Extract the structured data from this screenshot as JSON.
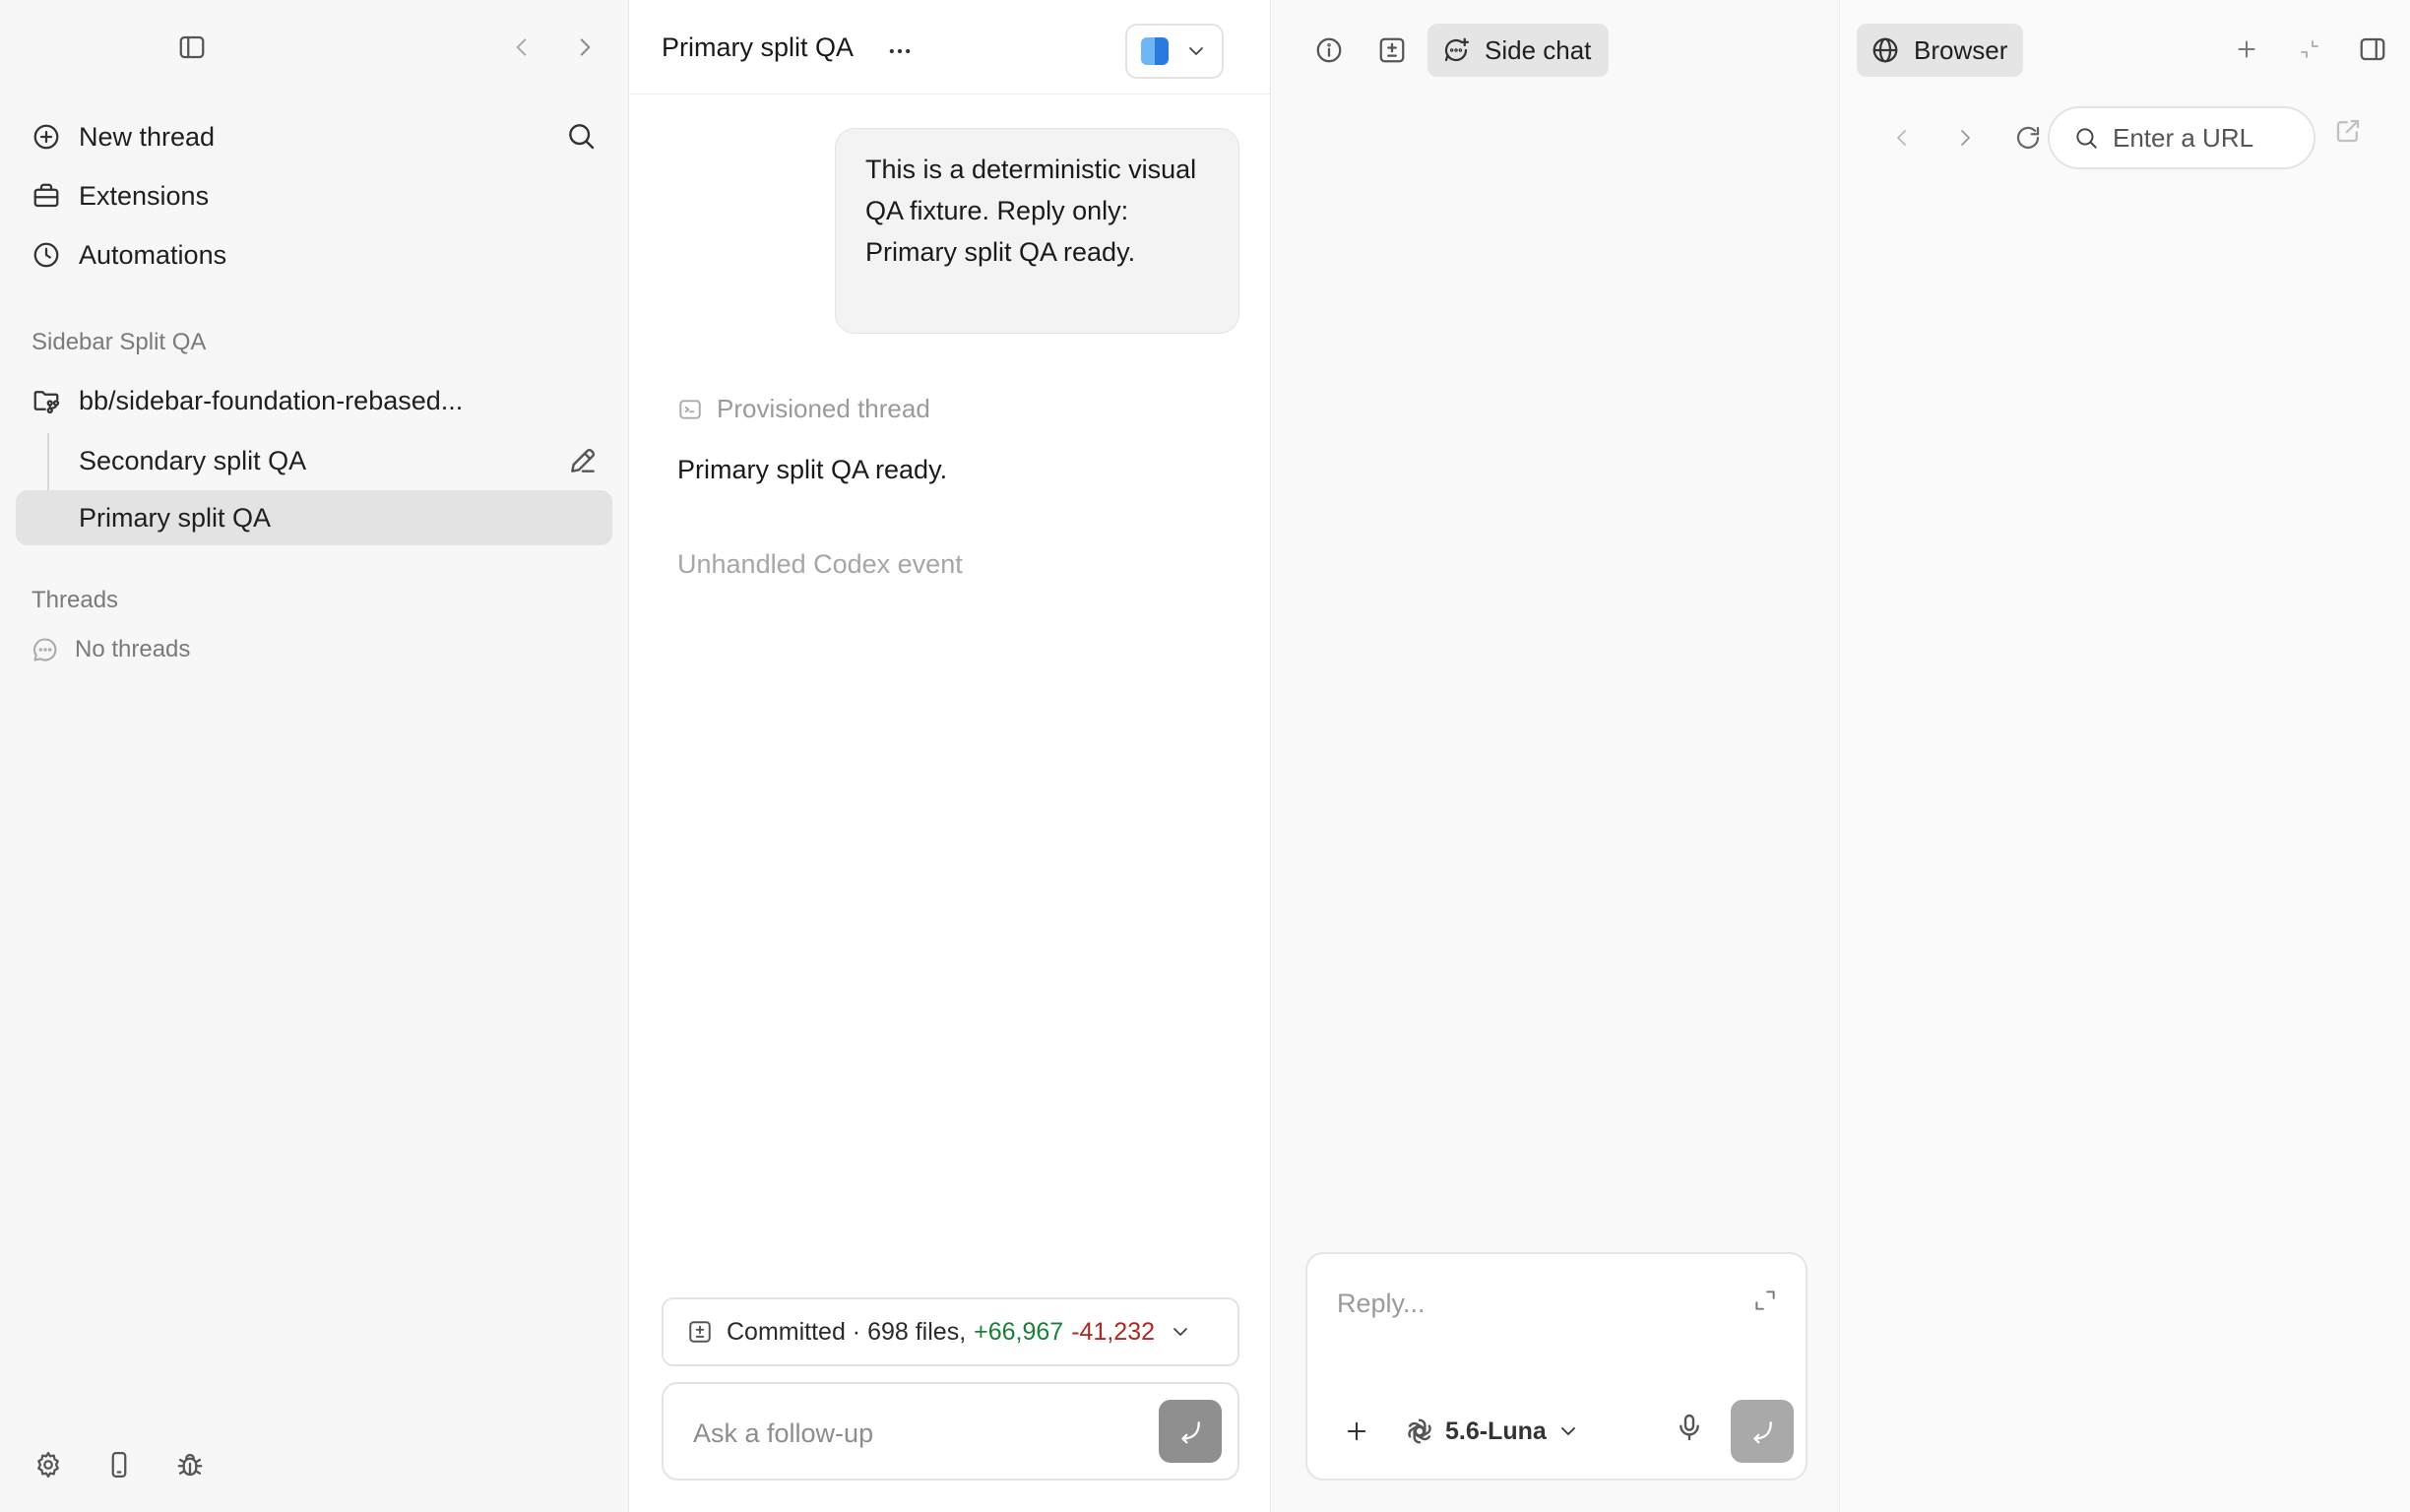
{
  "sidebar": {
    "nav": {
      "new_thread": "New thread",
      "extensions": "Extensions",
      "automations": "Automations"
    },
    "project_section": "Sidebar Split QA",
    "project_branch": "bb/sidebar-foundation-rebased...",
    "threads": [
      {
        "label": "Secondary split QA"
      },
      {
        "label": "Primary split QA"
      }
    ],
    "threads_section": "Threads",
    "no_threads": "No threads"
  },
  "main": {
    "title": "Primary split QA",
    "user_message": "This is a deterministic visual QA fixture. Reply only: Primary split QA ready.",
    "provisioned": "Provisioned thread",
    "assistant_reply": "Primary split QA ready.",
    "unhandled_event": "Unhandled Codex event",
    "commit": {
      "label": "Committed · 698 files,",
      "additions": "+66,967",
      "deletions": "-41,232"
    },
    "followup_placeholder": "Ask a follow-up"
  },
  "side_chat": {
    "tab_label": "Side chat",
    "reply_placeholder": "Reply...",
    "model": "5.6-Luna"
  },
  "browser": {
    "tab_label": "Browser",
    "url_placeholder": "Enter a URL"
  },
  "colors": {
    "additions": "#1a7f37",
    "deletions": "#b3261e",
    "active_thread_bg": "#e3e3e3"
  }
}
